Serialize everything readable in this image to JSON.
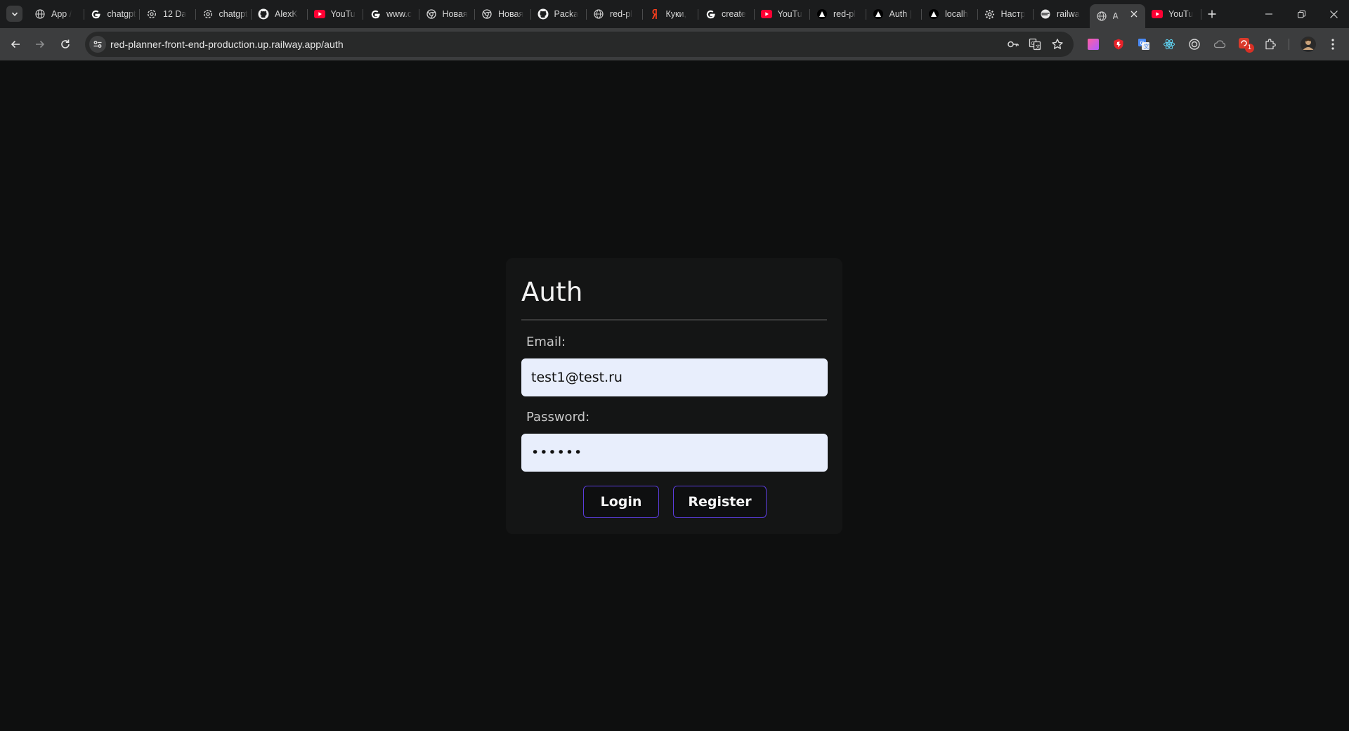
{
  "browser": {
    "tabs": [
      {
        "title": "App /",
        "icon": "globe-icon"
      },
      {
        "title": "chatgpt",
        "icon": "google-icon"
      },
      {
        "title": "12 Da",
        "icon": "openai-icon"
      },
      {
        "title": "chatgpt",
        "icon": "openai-icon"
      },
      {
        "title": "AlexK",
        "icon": "github-icon"
      },
      {
        "title": "YouTu",
        "icon": "youtube-icon"
      },
      {
        "title": "www.c",
        "icon": "google-icon"
      },
      {
        "title": "Новая",
        "icon": "chrome-icon"
      },
      {
        "title": "Новая",
        "icon": "chrome-icon"
      },
      {
        "title": "Packa",
        "icon": "github-icon"
      },
      {
        "title": "red-pl",
        "icon": "globe-icon"
      },
      {
        "title": "Куки,",
        "icon": "yandex-icon"
      },
      {
        "title": "create",
        "icon": "google-icon"
      },
      {
        "title": "YouTu",
        "icon": "youtube-icon"
      },
      {
        "title": "red-pl",
        "icon": "triangle-icon"
      },
      {
        "title": "Auth |",
        "icon": "triangle-icon"
      },
      {
        "title": "localh",
        "icon": "triangle-icon"
      },
      {
        "title": "Настр",
        "icon": "gear-icon"
      },
      {
        "title": "railwa",
        "icon": "railway-icon"
      },
      {
        "title": "A",
        "icon": "globe-icon",
        "active": true
      },
      {
        "title": "YouTu",
        "icon": "youtube-icon"
      }
    ],
    "url": "red-planner-front-end-production.up.railway.app/auth",
    "extension_badge": "1"
  },
  "auth": {
    "title": "Auth",
    "email_label": "Email:",
    "email_value": "test1@test.ru",
    "password_label": "Password:",
    "password_value": "••••••",
    "login_label": "Login",
    "register_label": "Register"
  },
  "colors": {
    "page_bg": "#0e0f0f",
    "card_bg": "#141515",
    "input_bg": "#e8eefc",
    "button_border": "#5b3ddc"
  }
}
